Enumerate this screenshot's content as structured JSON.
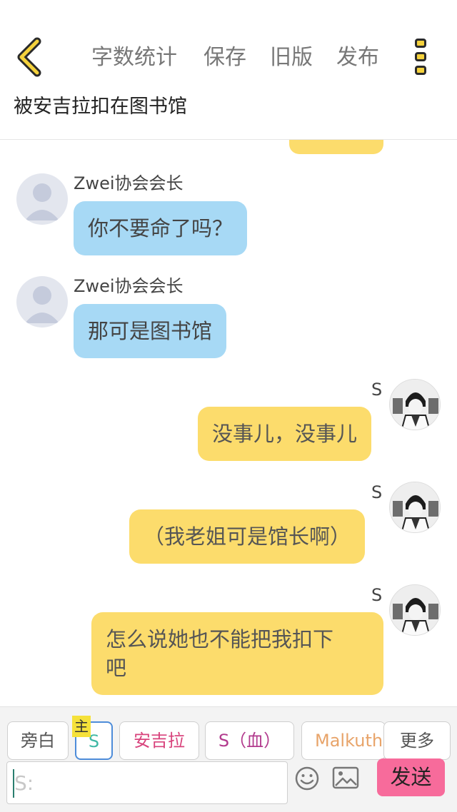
{
  "header": {
    "back_icon": "chevron-left-icon",
    "toolbar": {
      "word_count": "字数统计",
      "save": "保存",
      "old_version": "旧版",
      "publish": "发布"
    },
    "more_icon": "more-vertical-icon",
    "story_title": "被安吉拉扣在图书馆"
  },
  "chat": {
    "messages": [
      {
        "side": "left",
        "sender": "Zwei协会会长",
        "text": "你不要命了吗？",
        "avatar": "default-avatar-icon"
      },
      {
        "side": "left",
        "sender": "Zwei协会会长",
        "text": "那可是图书馆",
        "avatar": "default-avatar-icon"
      },
      {
        "side": "right",
        "sender": "S",
        "text": "没事儿，没事儿",
        "avatar": "character-avatar"
      },
      {
        "side": "right",
        "sender": "S",
        "text": "（我老姐可是馆长啊）",
        "avatar": "character-avatar"
      },
      {
        "side": "right",
        "sender": "S",
        "text": "怎么说她也不能把我扣下\n吧",
        "avatar": "character-avatar"
      }
    ]
  },
  "footer": {
    "roles": {
      "narration": "旁白",
      "host_badge": "主",
      "s": "S",
      "angela": "安吉拉",
      "s_blood": "S（血）",
      "malkuth": "Malkuth",
      "more": "更多"
    },
    "input_placeholder": "S:",
    "emoji_icon": "emoji-icon",
    "image_icon": "image-icon",
    "send": "发送"
  },
  "colors": {
    "bubble_left": "#a7d9f5",
    "bubble_right": "#fcdc6c",
    "send_button": "#f76b9b",
    "accent_yellow": "#f5d23c"
  }
}
